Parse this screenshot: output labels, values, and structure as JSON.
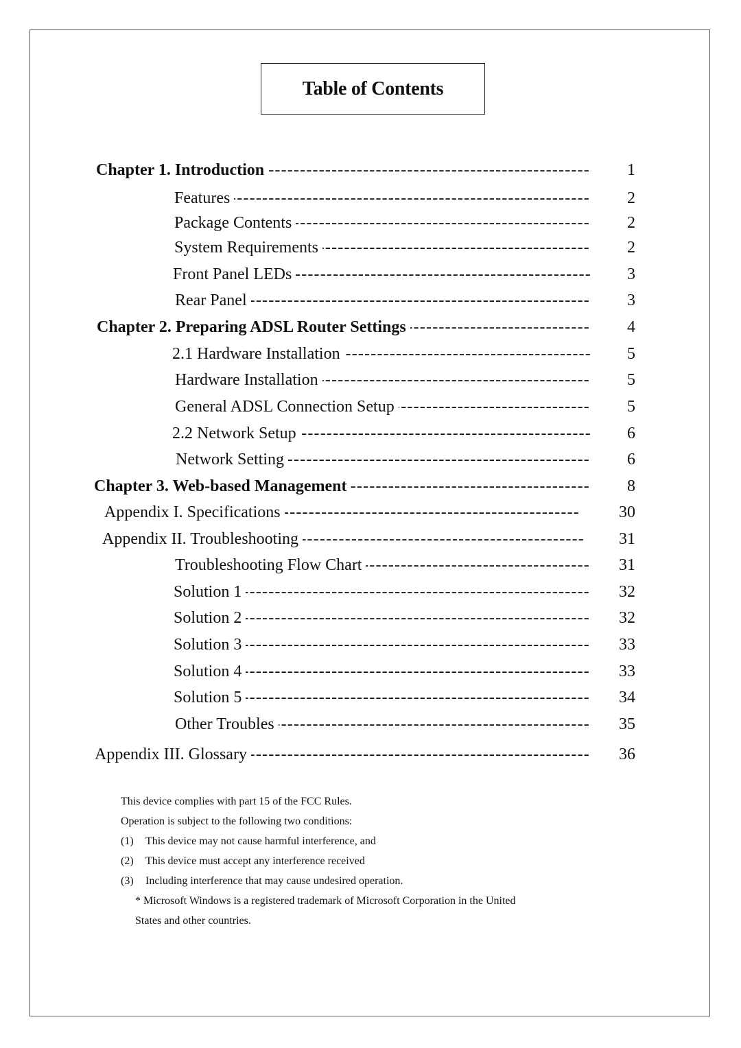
{
  "title": "Table of Contents",
  "entries": [
    {
      "label": "Chapter 1. Introduction",
      "page": "1",
      "bold": true,
      "level": "chapter"
    },
    {
      "label": "Features",
      "page": "2",
      "bold": false,
      "level": "sub"
    },
    {
      "label": "Package Contents",
      "page": "2",
      "bold": false,
      "level": "sub"
    },
    {
      "label": "System Requirements",
      "page": "2",
      "bold": false,
      "level": "sub"
    },
    {
      "label": "Front Panel LEDs",
      "page": "3",
      "bold": false,
      "level": "sub"
    },
    {
      "label": "Rear Panel",
      "page": "3",
      "bold": false,
      "level": "sub"
    },
    {
      "label": "Chapter 2. Preparing ADSL Router Settings",
      "page": "4",
      "bold": true,
      "level": "chapter"
    },
    {
      "label": "2.1 Hardware Installation",
      "page": "5",
      "bold": false,
      "level": "sub"
    },
    {
      "label": "Hardware Installation",
      "page": "5",
      "bold": false,
      "level": "sub"
    },
    {
      "label": "General ADSL Connection Setup",
      "page": "5",
      "bold": false,
      "level": "sub"
    },
    {
      "label": "2.2 Network Setup",
      "page": "6",
      "bold": false,
      "level": "sub"
    },
    {
      "label": "Network Setting",
      "page": "6",
      "bold": false,
      "level": "sub"
    },
    {
      "label": "Chapter 3. Web-based Management",
      "page": "8",
      "bold": true,
      "level": "chapter"
    },
    {
      "label": "Appendix I. Specifications",
      "page": "30",
      "bold": false,
      "level": "appendix"
    },
    {
      "label": "Appendix II. Troubleshooting",
      "page": "31",
      "bold": false,
      "level": "appendix"
    },
    {
      "label": "Troubleshooting Flow Chart",
      "page": "31",
      "bold": false,
      "level": "sub"
    },
    {
      "label": "Solution 1",
      "page": "32",
      "bold": false,
      "level": "sub"
    },
    {
      "label": "Solution 2",
      "page": "32",
      "bold": false,
      "level": "sub"
    },
    {
      "label": "Solution 3",
      "page": "33",
      "bold": false,
      "level": "sub"
    },
    {
      "label": "Solution 4",
      "page": "33",
      "bold": false,
      "level": "sub"
    },
    {
      "label": "Solution 5",
      "page": "34",
      "bold": false,
      "level": "sub"
    },
    {
      "label": "Other Troubles",
      "page": "35",
      "bold": false,
      "level": "sub"
    },
    {
      "label": "Appendix III.  Glossary",
      "page": "36",
      "bold": false,
      "level": "chapter"
    }
  ],
  "notes": {
    "line1": "This device complies with part 15 of the FCC Rules.",
    "line2": "Operation is subject to the following two conditions:",
    "items": [
      {
        "num": "(1)",
        "text": "This device may not cause harmful interference, and"
      },
      {
        "num": "(2)",
        "text": "This device must accept any interference received"
      },
      {
        "num": "(3)",
        "text": "Including interference that may cause undesired operation."
      }
    ],
    "trademark_line1": "* Microsoft Windows is a registered trademark of Microsoft Corporation in the United",
    "trademark_line2": "States and other countries."
  }
}
